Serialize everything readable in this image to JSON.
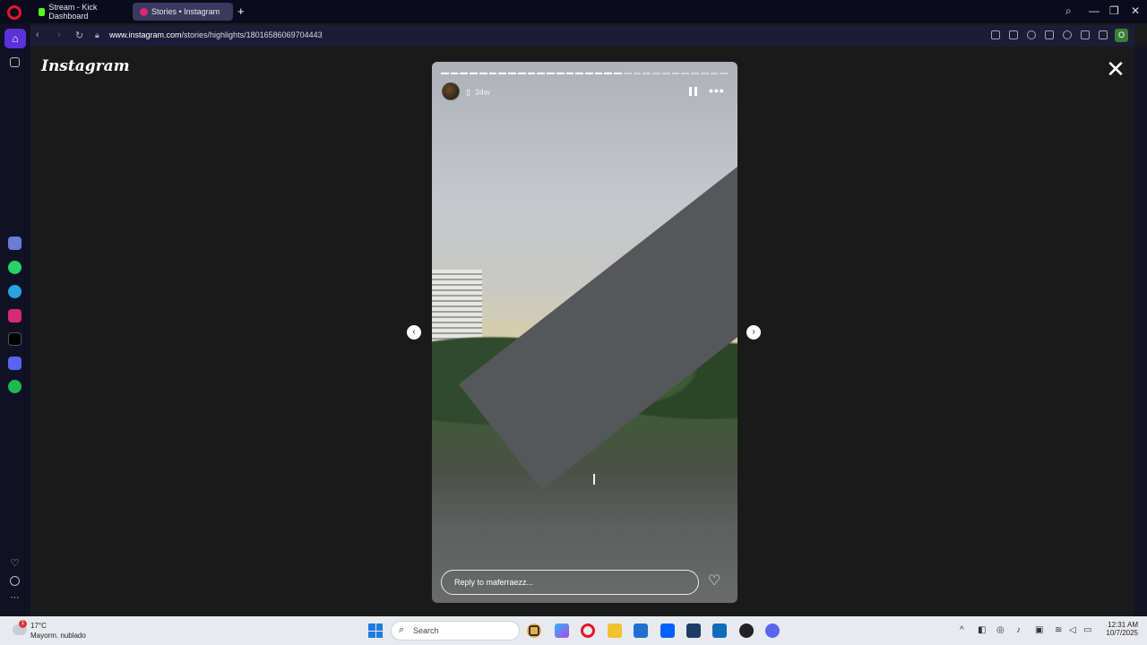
{
  "browser": {
    "tabs": [
      {
        "label": "Stream - Kick Dashboard",
        "favicon_color": "#53fc18"
      },
      {
        "label": "Stories • Instagram",
        "favicon_color": "#d62976"
      }
    ],
    "address": {
      "host": "www.instagram.com",
      "path": "/stories/highlights/18016586069704443"
    },
    "profile_initial": "O"
  },
  "page": {
    "logo": "Instagram",
    "story": {
      "time_ago": "34w",
      "reply_placeholder": "Reply to maferraezz...",
      "progress_total": 30,
      "progress_done": 19
    }
  },
  "taskbar": {
    "weather": {
      "temp": "17°C",
      "desc": "Mayorm. nublado",
      "badge": "1"
    },
    "search_placeholder": "Search",
    "clock": {
      "time": "12:31 AM",
      "date": "10/7/2025"
    }
  },
  "colors": {
    "accent": "#5a32d8",
    "opera_red": "#e4162c",
    "page_bg": "#1a1a1a"
  }
}
